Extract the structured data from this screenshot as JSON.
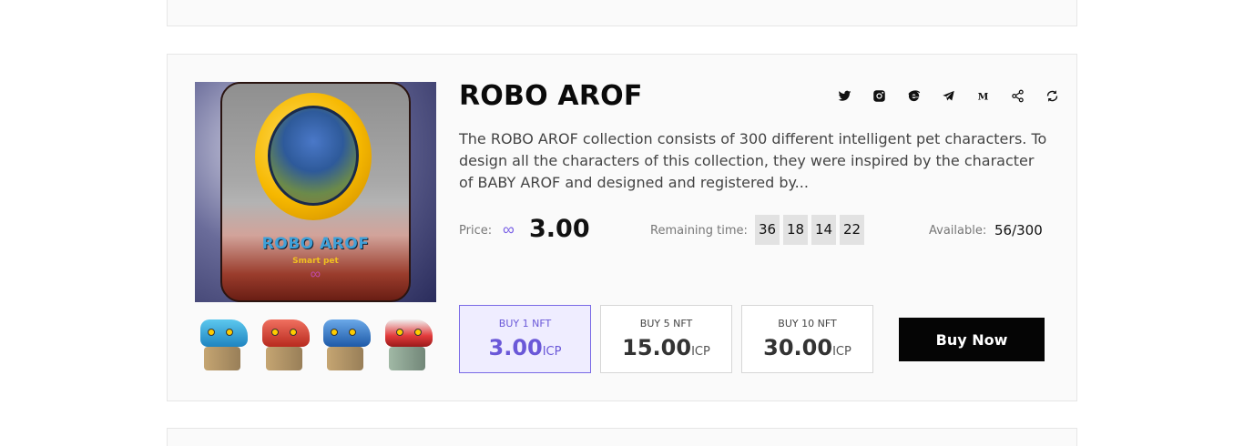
{
  "collection": {
    "name": "ROBO AROF",
    "description": "The ROBO AROF collection consists of 300 different intelligent pet characters. To design all the characters of this collection, they were inspired by the character of BABY AROF and designed and registered by...",
    "image": {
      "title_text": "ROBO AROF",
      "subtitle_text": "Smart pet",
      "symbol": "∞"
    },
    "thumbnails": [
      {
        "name": "robo-pet-thumb-1",
        "color": "#2fa8d8"
      },
      {
        "name": "robo-pet-thumb-2",
        "color": "#d84a3a"
      },
      {
        "name": "robo-pet-thumb-3",
        "color": "#2a7ac8"
      },
      {
        "name": "robo-pet-thumb-4",
        "color": "#e23b3b"
      }
    ]
  },
  "socials": [
    {
      "name": "twitter-icon",
      "glyph": "twitter"
    },
    {
      "name": "instagram-icon",
      "glyph": "instagram"
    },
    {
      "name": "website-icon",
      "glyph": "e"
    },
    {
      "name": "telegram-icon",
      "glyph": "telegram"
    },
    {
      "name": "medium-icon",
      "glyph": "M"
    },
    {
      "name": "share-icon",
      "glyph": "share"
    },
    {
      "name": "refresh-icon",
      "glyph": "refresh"
    }
  ],
  "price": {
    "label": "Price:",
    "currency_symbol": "∞",
    "value": "3.00"
  },
  "remaining": {
    "label": "Remaining time:",
    "parts": [
      "36",
      "18",
      "14",
      "22"
    ]
  },
  "available": {
    "label": "Available:",
    "value": "56/300"
  },
  "options": [
    {
      "label": "BUY 1 NFT",
      "amount": "3.00",
      "unit": "ICP",
      "selected": true
    },
    {
      "label": "BUY 5 NFT",
      "amount": "15.00",
      "unit": "ICP",
      "selected": false
    },
    {
      "label": "BUY 10 NFT",
      "amount": "30.00",
      "unit": "ICP",
      "selected": false
    }
  ],
  "buy_now_label": "Buy Now",
  "colors": {
    "accent": "#7a6ae6",
    "button": "#050505",
    "card_bg": "#fafafa"
  }
}
